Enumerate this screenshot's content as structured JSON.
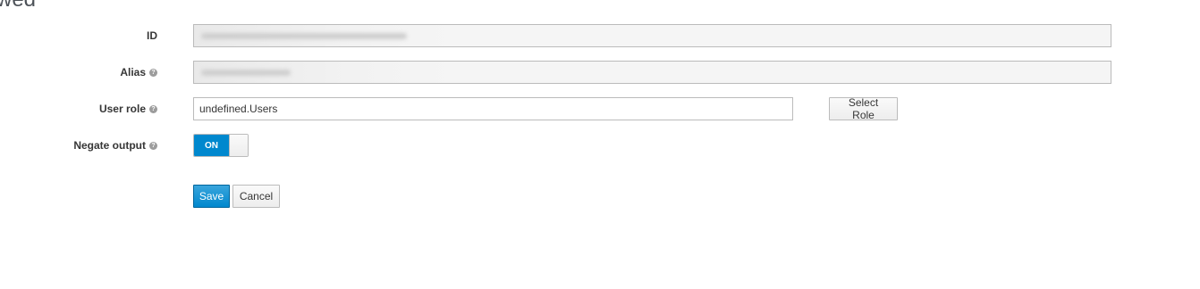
{
  "page": {
    "heading_fragment": "wed"
  },
  "form": {
    "id": {
      "label": "ID",
      "value": ""
    },
    "alias": {
      "label": "Alias",
      "value": ""
    },
    "user_role": {
      "label": "User role",
      "value": "undefined.Users",
      "select_button": "Select Role"
    },
    "negate_output": {
      "label": "Negate output",
      "toggle_state": "ON",
      "toggle_on": true
    }
  },
  "actions": {
    "save": "Save",
    "cancel": "Cancel"
  },
  "colors": {
    "primary": "#0088ce",
    "primary_border": "#00659c",
    "readonly_bg": "#f5f5f5"
  },
  "icons": {
    "help": "question-circle-icon"
  }
}
